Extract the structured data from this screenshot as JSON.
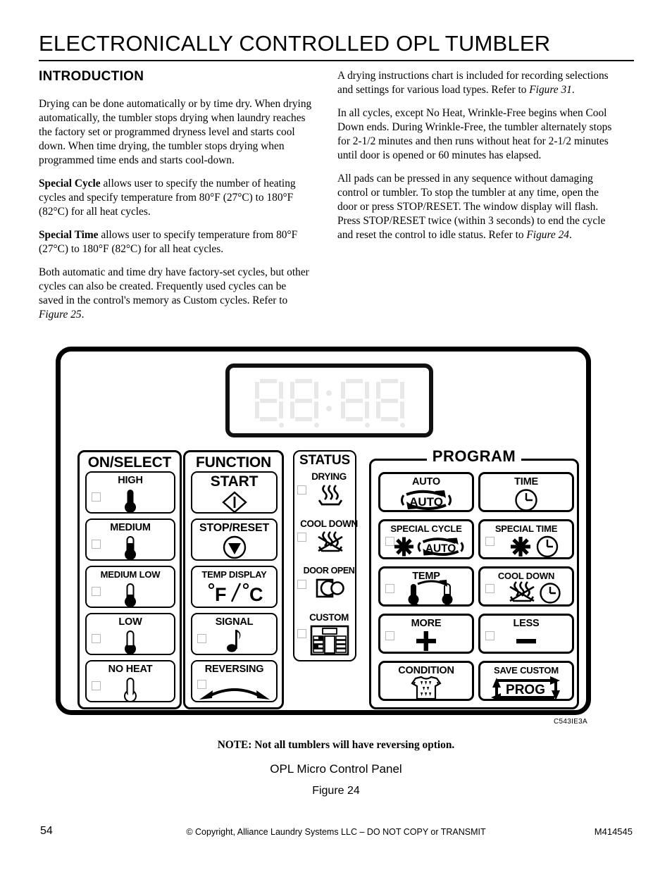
{
  "header": {
    "title": "ELECTRONICALLY CONTROLLED OPL TUMBLER",
    "section_heading": "INTRODUCTION"
  },
  "left_column": {
    "p1": "Drying can be done automatically or by time dry.  When drying automatically, the tumbler stops drying when laundry reaches the factory set or programmed dryness level and starts cool down.  When time drying, the tumbler stops drying when programmed time ends and starts cool-down.",
    "p2_bold": "Special Cycle",
    "p2": " allows user to specify the number of heating cycles and specify temperature from 80°F (27°C) to 180°F (82°C) for all heat cycles.",
    "p3_bold": "Special Time",
    "p3": " allows user to specify temperature from 80°F (27°C) to 180°F (82°C) for all heat cycles.",
    "p4a": "Both automatic and time dry have factory-set cycles, but other cycles can also be created.  Frequently used cycles can be saved in the control's memory as Custom cycles.  Refer to ",
    "p4_italic": "Figure 25",
    "p4b": "."
  },
  "right_column": {
    "p1a": "A drying instructions chart is included for recording selections and settings for various load types. Refer to ",
    "p1_italic": "Figure 31",
    "p1b": ".",
    "p2": "In all cycles, except No Heat, Wrinkle-Free begins when Cool Down ends.  During Wrinkle-Free, the tumbler alternately stops for 2-1/2 minutes and then runs without heat for 2-1/2 minutes until door is opened or 60 minutes has elapsed.",
    "p3a": "All pads can be pressed in any sequence without damaging control or tumbler.  To stop the tumbler at any time, open the door or press STOP/RESET.  The window display will flash.  Press STOP/RESET twice (within 3 seconds) to end the cycle and reset the control to idle status. Refer to ",
    "p3_italic": "Figure 24",
    "p3b": "."
  },
  "panel": {
    "display": {
      "digits": [
        "8",
        "8",
        "8",
        "8"
      ],
      "colon": ":",
      "state": "off"
    },
    "groups": {
      "on_select": "ON/SELECT",
      "function": "FUNCTION",
      "status": "STATUS",
      "program": "PROGRAM"
    },
    "on_select_keys": [
      {
        "label": "HIGH",
        "icon": "thermometer-full-icon",
        "has_led": true
      },
      {
        "label": "MEDIUM",
        "icon": "thermometer-three-quarter-icon",
        "has_led": true
      },
      {
        "label": "MEDIUM LOW",
        "icon": "thermometer-half-icon",
        "has_led": true
      },
      {
        "label": "LOW",
        "icon": "thermometer-low-icon",
        "has_led": true
      },
      {
        "label": "NO HEAT",
        "icon": "thermometer-empty-icon",
        "has_led": true
      }
    ],
    "function_keys": [
      {
        "label": "START",
        "icon": "start-diamond-icon",
        "has_led": false
      },
      {
        "label": "STOP/RESET",
        "icon": "stop-triangle-icon",
        "has_led": false
      },
      {
        "label": "TEMP DISPLAY",
        "icon": "fahrenheit-celsius-icon",
        "value": "°F / °C",
        "has_led": false
      },
      {
        "label": "SIGNAL",
        "icon": "music-note-icon",
        "has_led": true
      },
      {
        "label": "REVERSING",
        "icon": "reversing-arrow-icon",
        "has_led": true
      }
    ],
    "status_items": [
      {
        "label": "DRYING",
        "icon": "heat-waves-icon",
        "has_led": true
      },
      {
        "label": "COOL DOWN",
        "icon": "no-heat-waves-icon",
        "has_led": true
      },
      {
        "label": "DOOR OPEN",
        "icon": "door-open-icon",
        "has_led": true
      },
      {
        "label": "CUSTOM",
        "icon": "custom-grid-icon",
        "has_led": true
      }
    ],
    "program_keys": [
      {
        "label": "AUTO",
        "icon": "auto-cycle-icon",
        "icon_text": "AUTO",
        "has_led": false
      },
      {
        "label": "TIME",
        "icon": "clock-icon",
        "has_led": false
      },
      {
        "label": "SPECIAL CYCLE",
        "icon": "star-auto-icon",
        "icon_text": "AUTO",
        "has_led": true
      },
      {
        "label": "SPECIAL TIME",
        "icon": "star-clock-icon",
        "has_led": true
      },
      {
        "label": "TEMP",
        "icon": "temp-swap-icon",
        "has_led": true
      },
      {
        "label": "COOL DOWN",
        "icon": "no-heat-clock-icon",
        "has_led": true
      },
      {
        "label": "MORE",
        "icon": "plus-icon",
        "has_led": true
      },
      {
        "label": "LESS",
        "icon": "minus-icon",
        "has_led": true
      },
      {
        "label": "CONDITION",
        "icon": "wet-shirt-icon",
        "has_led": false
      },
      {
        "label": "SAVE CUSTOM",
        "icon": "prog-arrows-icon",
        "icon_text": "PROG",
        "has_led": false
      }
    ]
  },
  "figure": {
    "drawing_number": "C543IE3A",
    "note": "NOTE: Not all tumblers will have reversing option.",
    "title": "OPL Micro Control Panel",
    "number": "Figure 24"
  },
  "footer": {
    "page_number": "54",
    "copyright": "© Copyright, Alliance Laundry Systems LLC – DO NOT COPY or TRANSMIT",
    "document_code": "M414545"
  }
}
